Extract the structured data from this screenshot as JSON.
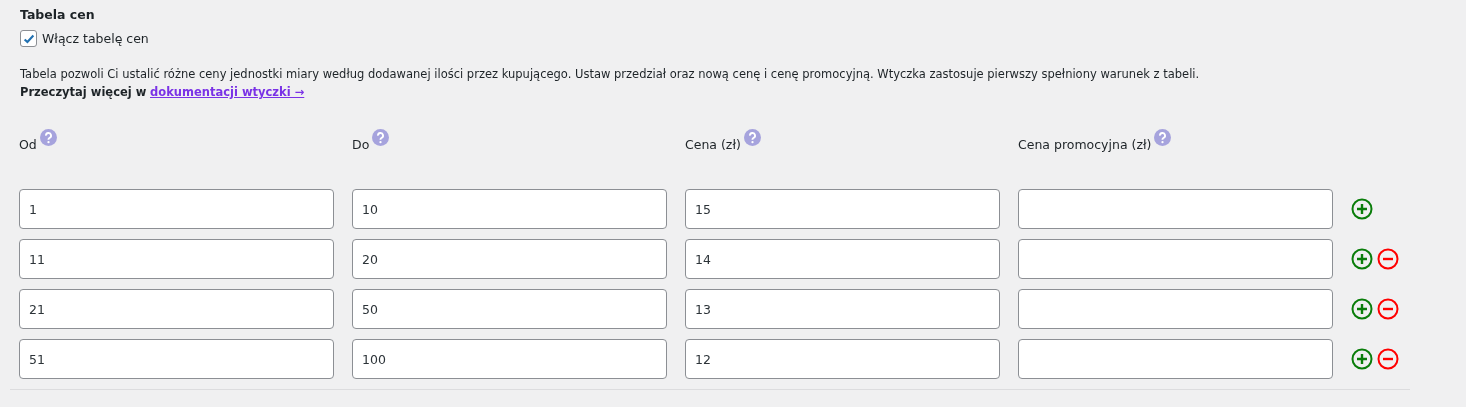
{
  "section_title": "Tabela cen",
  "enable": {
    "label": "Włącz tabelę cen",
    "checked": true
  },
  "description": "Tabela pozwoli Ci ustalić różne ceny jednostki miary według dodawanej ilości przez kupującego. Ustaw przedział oraz nową cenę i cenę promocyjną. Wtyczka zastosuje pierwszy spełniony warunek z tabeli.",
  "read_more": {
    "text": "Przeczytaj więcej w",
    "link": "dokumentacji wtyczki →"
  },
  "columns": [
    "Od",
    "Do",
    "Cena (zł)",
    "Cena promocyjna (zł)"
  ],
  "rows": [
    {
      "values": [
        "1",
        "10",
        "15"
      ],
      "removable": false
    },
    {
      "values": [
        "11",
        "20",
        "14"
      ],
      "removable": true
    },
    {
      "values": [
        "21",
        "50",
        "13"
      ],
      "removable": true
    },
    {
      "values": [
        "51",
        "100",
        "12"
      ],
      "removable": true
    }
  ]
}
